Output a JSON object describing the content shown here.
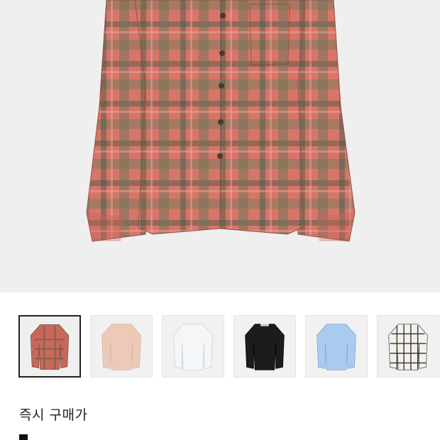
{
  "product": {
    "main_image": "plaid-shirt-red-green",
    "thumbnails": [
      {
        "name": "plaid-red-green",
        "color": "#c9675a",
        "selected": true
      },
      {
        "name": "pink",
        "color": "#efc9b8",
        "selected": false
      },
      {
        "name": "white",
        "color": "#f4f6f8",
        "selected": false
      },
      {
        "name": "black",
        "color": "#1c1c1e",
        "selected": false
      },
      {
        "name": "light-blue",
        "color": "#a9cbef",
        "selected": false
      },
      {
        "name": "white-check",
        "color": "#f3f1ea",
        "selected": false
      }
    ]
  },
  "purchase": {
    "title": "즉시 구매가"
  },
  "colors": {
    "hero_bg": "#efefef",
    "plaid_red": "#d66f63",
    "plaid_green": "#4e6047",
    "text": "#222222"
  }
}
